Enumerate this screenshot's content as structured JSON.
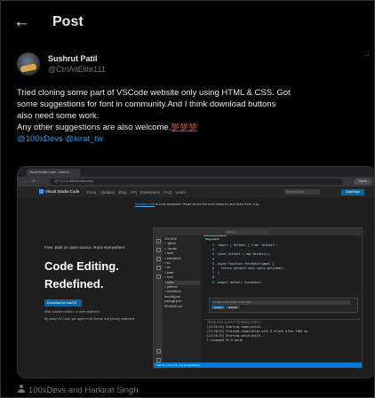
{
  "header": {
    "back_icon": "arrow-left-icon",
    "title": "Post"
  },
  "tweet": {
    "author_name": "Sushrut Patil",
    "author_handle": "@CtrlAltElite111",
    "more_icon": "more-dots-icon",
    "text_lines": [
      "Tried cloning some part of VSCode website only using HTML & CSS. Got",
      "some suggestions for font in community.And I think download buttons",
      "also need some work.",
      "Any other suggestions are also welcome."
    ],
    "emoji": "💯💯💯",
    "mentions": "@100xDevs @kirat_tw"
  },
  "media": {
    "browser_tab": "Visual Studio Code - Code E…",
    "url": "127.0.0.1:5500/index.html",
    "profile_button": "Guest",
    "site": {
      "logo": "Visual Studio Code",
      "nav": "Docs Updates Blog API Extensions FAQ Learn",
      "search_placeholder": "Search Docs",
      "download_top": "Download",
      "announcement_link": "Version 1.92",
      "announcement_rest": " is now available! Read about the new features and fixes from July.",
      "hero_tagline": "Free. Built on open source. Runs everywhere.",
      "hero_line1": "Code Editing.",
      "hero_line2": "Redefined.",
      "hero_button": "Download for macOS",
      "hero_small": "Web, Insiders edition, or other platforms",
      "hero_small2": "By using VS Code, you agree to its license and privacy statement.",
      "editor": {
        "search": "vscode",
        "tab": "blog-post.ts",
        "explorer": [
          "VSCODE",
          "> .github",
          "> .vscode",
          "> build",
          "> extensions",
          "v src",
          "  > vs",
          "    > base",
          "    > code",
          "    > editor",
          "    > platform",
          "    > workbench",
          "  tsconfig.json",
          "  package.json",
          "  README.md"
        ],
        "code_lines": [
          "1  import { Octokit } from 'octokit';",
          "2  ",
          "3  const octokit = new Octokit();",
          "4  ",
          "5  async function fetchUser(name) {",
          "6    return octokit.rest.users.get(name);",
          "7  }",
          "8  ",
          "9  export default fetchUser;"
        ],
        "copilot_prompt": "Create a new button component",
        "copilot_accept": "Accept",
        "copilot_discard": "Discard",
        "panel_tabs": "PROBLEMS   OUTPUT   TERMINAL   PORTS",
        "panel_lines": [
          "[13:26:24] Starting compilation...",
          "[13:26:25] Finished compilation with 0 errors after 1062 ms",
          "[13:26:25] Starting watch-build...",
          "> vscode@1.92.0 watch"
        ],
        "status": "main   0 ⚠ 0   Ln 21, Col 10   TypeScript"
      }
    }
  },
  "footer": {
    "text": "100xDevs and Harkirat Singh",
    "icon": "person-icon"
  }
}
